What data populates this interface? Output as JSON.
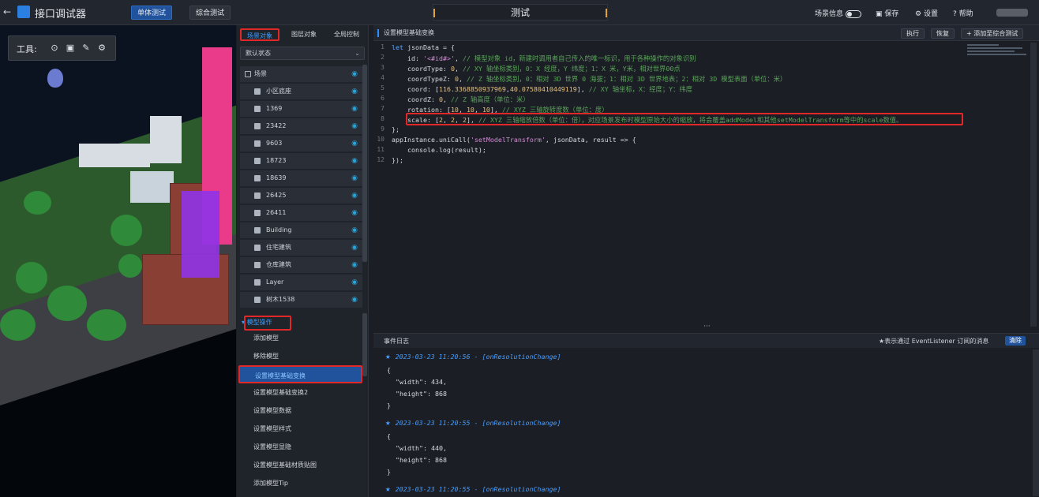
{
  "topbar": {
    "back_icon": "arrow-left-icon",
    "title": "接口调试器",
    "mode_buttons": [
      "单体测试",
      "综合测试"
    ],
    "center_title": "测试",
    "scene_info_label": "场景信息",
    "save_label": "保存",
    "settings_label": "设置",
    "help_label": "帮助"
  },
  "viewport": {
    "tool_label": "工具:",
    "tools": [
      "locate-icon",
      "frame-icon",
      "pen-icon",
      "gear-icon"
    ]
  },
  "panel": {
    "tabs": [
      "场景对象",
      "图层对象",
      "全局控制"
    ],
    "state_select": "默认状态",
    "root_label": "场景",
    "items": [
      "小区底座",
      "1369",
      "23422",
      "9603",
      "18723",
      "18639",
      "26425",
      "26411",
      "Building",
      "住宅建筑",
      "仓库建筑",
      "Layer",
      "树木1538"
    ],
    "section_title": "模型操作",
    "operations": [
      "添加模型",
      "移除模型",
      "设置模型基础变换",
      "设置模型基础变换2",
      "设置模型数据",
      "设置模型样式",
      "设置模型显隐",
      "设置模型基础材质贴图",
      "添加模型Tip"
    ]
  },
  "editor": {
    "title": "设置模型基础变换",
    "run_label": "执行",
    "reset_label": "恢复",
    "add_label": "添加至综合测试",
    "line_numbers": [
      "1",
      "2",
      "3",
      "4",
      "5",
      "6",
      "7",
      "8",
      "9",
      "10",
      "11",
      "12"
    ]
  },
  "log": {
    "title": "事件日志",
    "hint": "★表示通过 EventListener 订阅的消息",
    "clear_label": "清除",
    "entries": [
      {
        "time": "2023-03-23 11:20:56",
        "event": "[onResolutionChange]",
        "width": "434",
        "height": "868"
      },
      {
        "time": "2023-03-23 11:20:55",
        "event": "[onResolutionChange]",
        "width": "440",
        "height": "868"
      },
      {
        "time": "2023-03-23 11:20:55",
        "event": "[onResolutionChange]"
      }
    ]
  },
  "colors": {
    "accent": "#2f8cff",
    "highlight_border": "#e02828",
    "active_button": "#21539c"
  }
}
